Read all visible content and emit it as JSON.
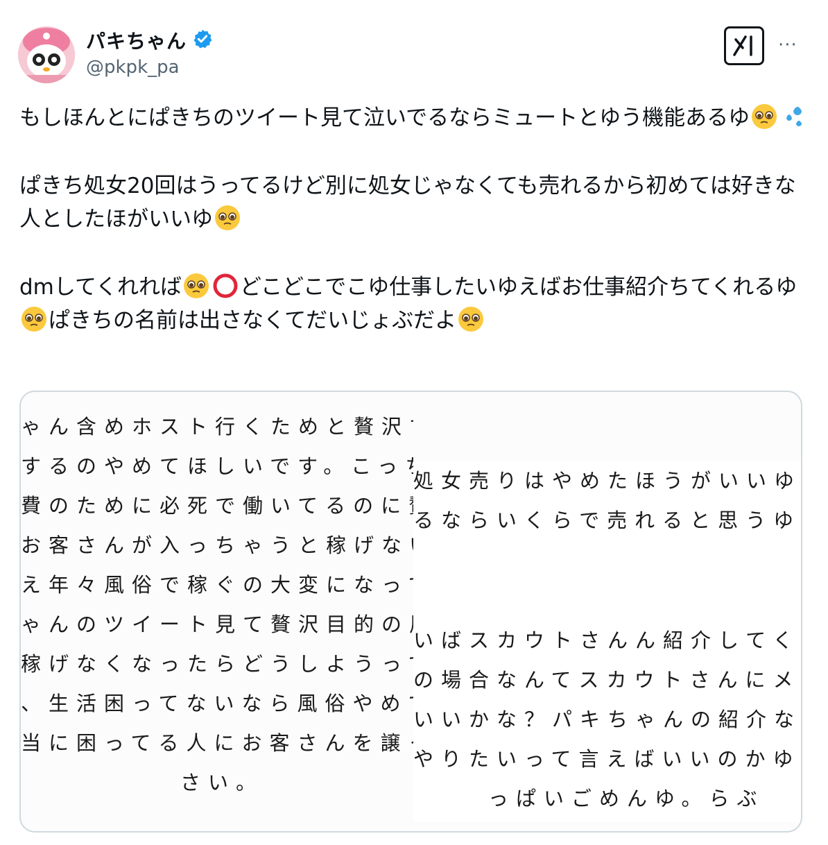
{
  "user": {
    "display_name": "パキちゃん",
    "handle": "@pkpk_pa",
    "verified_icon": "verified-badge-icon",
    "avatar_icon": "pink-character-avatar"
  },
  "actions": {
    "grok_icon": "grok-icon",
    "more_icon": "more-dots-icon",
    "more_label": "···"
  },
  "tweet": {
    "p1": {
      "t1": "もしほんとにぱきちのツイート見て泣いでるならミュートとゆう機能あるゆ"
    },
    "p2": {
      "t1": "ぱきち処女20回はうってるけど別に処女じゃなくても売れるから初めては好きな人としたほがいいゆ"
    },
    "p3": {
      "t1": "dmしてくれれば",
      "t2": "どこどこでこゆ仕事したいゆえばお仕事紹介ちてくれるゆ",
      "t3": "ぱきちの名前は出さなくてだいじょぶだよ"
    },
    "emoji": {
      "pleading": "pleading-face-icon",
      "sweat": "sweat-droplets-icon",
      "circle": "red-circle-icon"
    }
  },
  "media": {
    "left_lines": [
      "ゃん含めホスト行くためと贅沢す",
      "するのやめてほしいです。こっち",
      "費のために必死で働いてるのに贅",
      "お客さんが入っちゃうと稼げない",
      "え年々風俗で稼ぐの大変になって",
      "ゃんのツイート見て贅沢目的の風",
      "稼げなくなったらどうしようって",
      "、生活困ってないなら風俗やめて",
      "当に困ってる人にお客さんを譲っ",
      "さい。"
    ],
    "right_lines_top": [
      "処女売りはやめたほうがいいゆ",
      "るならいくらで売れると思うゆ"
    ],
    "right_lines_bottom": [
      "いばスカウトさんん紹介してくれ",
      "の場合なんてスカウトさんにメッ",
      "いいかな？パキちゃんの紹介なん",
      "やりたいって言えばいいのかゆ？",
      "っぱいごめんゆ。らぶ"
    ]
  }
}
